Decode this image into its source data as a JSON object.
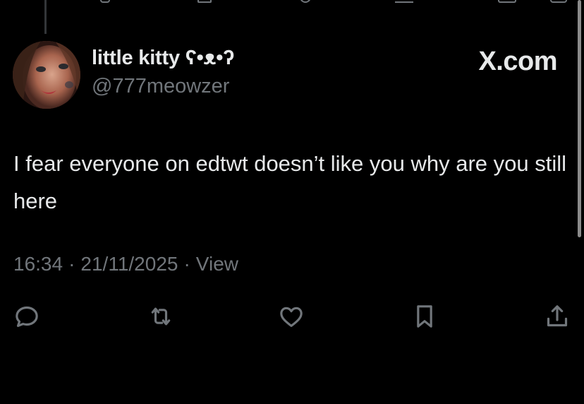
{
  "tweet": {
    "display_name": "little kitty ʕ•ᴥ•ʔ",
    "handle": "@777meowzer",
    "brand": "X.com",
    "text": "I fear everyone on edtwt doesn’t like you why are you still here",
    "time": "16:34",
    "separator": "·",
    "date": "21/11/2025",
    "views_label": "View"
  },
  "actions": [
    {
      "name": "reply",
      "icon": "reply-icon"
    },
    {
      "name": "retweet",
      "icon": "retweet-icon"
    },
    {
      "name": "like",
      "icon": "heart-icon"
    },
    {
      "name": "bookmark",
      "icon": "bookmark-icon"
    },
    {
      "name": "share",
      "icon": "share-icon"
    }
  ],
  "colors": {
    "background": "#000000",
    "text_primary": "#e7e9ea",
    "text_secondary": "#71767b",
    "icon": "#71767b",
    "thread_line": "#333639"
  }
}
